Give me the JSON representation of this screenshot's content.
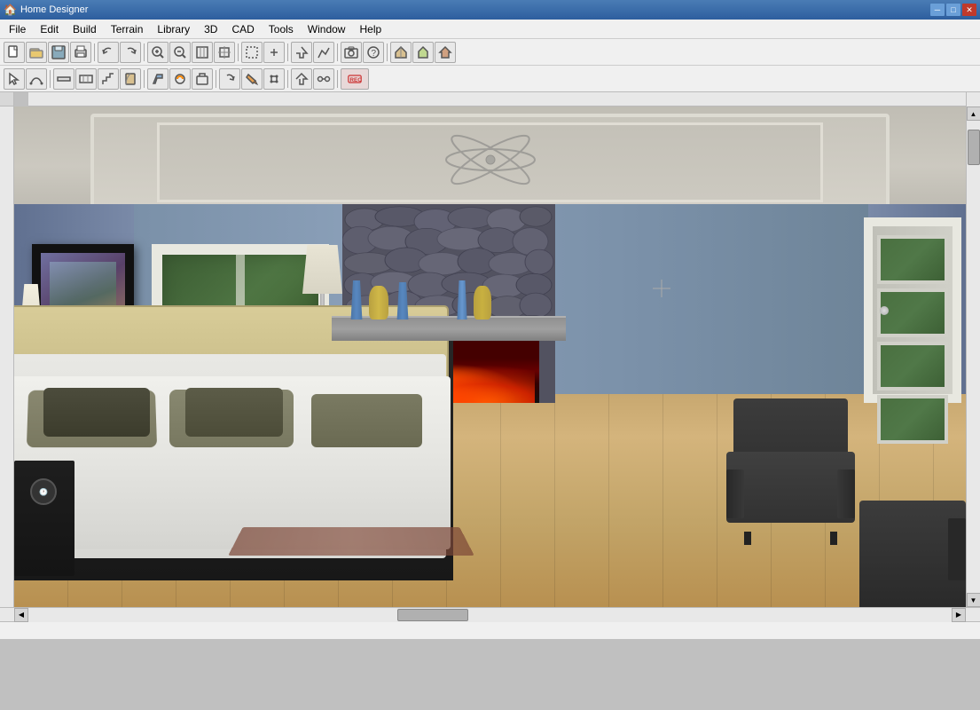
{
  "titleBar": {
    "title": "Home Designer",
    "icon": "🏠",
    "minimizeLabel": "─",
    "maximizeLabel": "□",
    "closeLabel": "✕"
  },
  "menuBar": {
    "items": [
      {
        "id": "file",
        "label": "File"
      },
      {
        "id": "edit",
        "label": "Edit"
      },
      {
        "id": "build",
        "label": "Build"
      },
      {
        "id": "terrain",
        "label": "Terrain"
      },
      {
        "id": "library",
        "label": "Library"
      },
      {
        "id": "3d",
        "label": "3D"
      },
      {
        "id": "cad",
        "label": "CAD"
      },
      {
        "id": "tools",
        "label": "Tools"
      },
      {
        "id": "window",
        "label": "Window"
      },
      {
        "id": "help",
        "label": "Help"
      }
    ]
  },
  "toolbar1": {
    "buttons": [
      "new",
      "open",
      "save",
      "print",
      "undo",
      "redo",
      "zoom-in-btn",
      "zoom-out-btn",
      "fit",
      "select-objects",
      "arrow-up",
      "camera",
      "help-btn",
      "house1",
      "house2",
      "house3"
    ]
  },
  "toolbar2": {
    "buttons": [
      "select",
      "arc-tool",
      "wall-tool",
      "floor-tool",
      "stair-tool",
      "door-tool",
      "paint",
      "material",
      "library-obj",
      "rotate",
      "color-fill",
      "transform",
      "arrow-right",
      "record"
    ]
  },
  "statusBar": {
    "text": ""
  }
}
